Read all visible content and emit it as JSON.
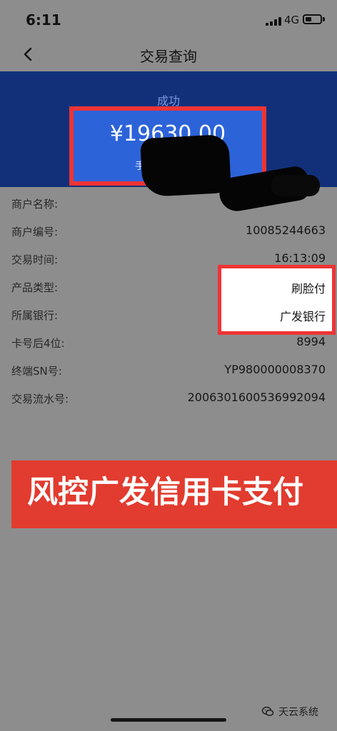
{
  "status_bar": {
    "time": "6:11",
    "network": "4G"
  },
  "navigation": {
    "title": "交易查询",
    "back_icon": "chevron-left-icon"
  },
  "header": {
    "status": "成功",
    "amount": "¥19630.00",
    "fee_label_partial": "手"
  },
  "details": {
    "rows": [
      {
        "label": "商户名称:",
        "value": ""
      },
      {
        "label": "商户编号:",
        "value": "10085244663"
      },
      {
        "label": "交易时间:",
        "value": "16:13:09"
      },
      {
        "label": "产品类型:",
        "value": "刷脸付"
      },
      {
        "label": "所属银行:",
        "value": "广发银行"
      },
      {
        "label": "卡号后4位:",
        "value": "8994"
      },
      {
        "label": "终端SN号:",
        "value": "YP980000008370"
      },
      {
        "label": "交易流水号:",
        "value": "2006301600536992094"
      }
    ]
  },
  "banner": {
    "text": "风控广发信用卡支付"
  },
  "watermark": {
    "text": "天云系统",
    "icon": "wechat-icon"
  },
  "colors": {
    "page_background": "#8d8d8d",
    "header_background": "#12307a",
    "amount_card": "#2d63d9",
    "highlight_red": "#ee3434",
    "banner_red": "#e23b2f"
  }
}
